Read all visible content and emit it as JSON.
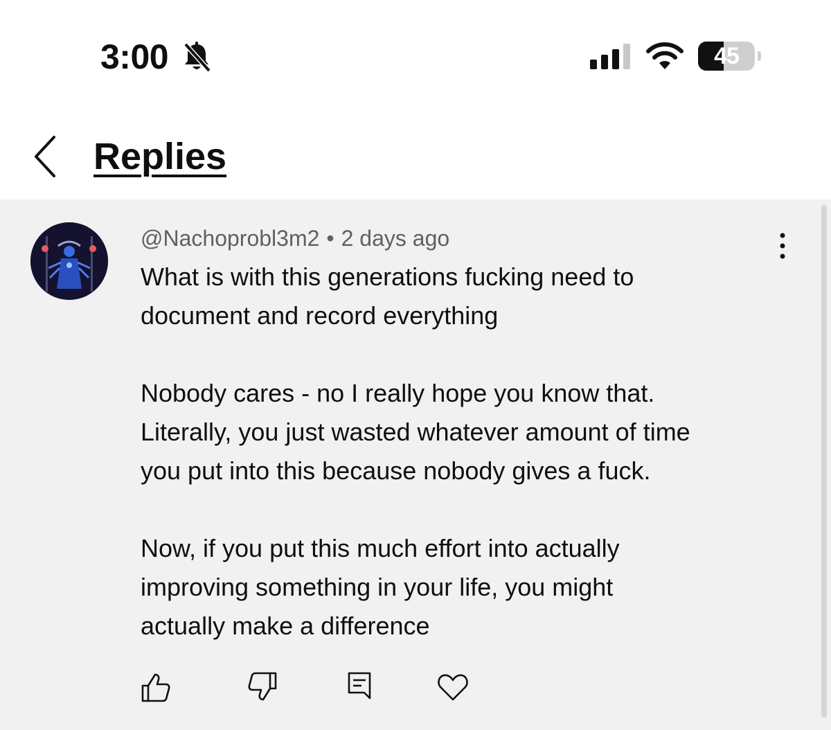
{
  "status_bar": {
    "time": "3:00",
    "battery_level": "45",
    "battery_fraction": 0.45,
    "icons": [
      "bell-off-icon",
      "cellular-signal-icon",
      "wifi-icon",
      "battery-icon"
    ]
  },
  "header": {
    "back_icon": "chevron-left-icon",
    "title": "Replies"
  },
  "comment": {
    "author": "@Nachoprobl3m2",
    "separator": "•",
    "timestamp": "2 days ago",
    "more_icon": "vertical-ellipsis-icon",
    "lines": [
      "What is with this generations fucking need to",
      "document and record everything",
      "",
      "Nobody cares - no I really hope you know that.",
      "Literally, you just wasted whatever amount of time",
      "you put into this because nobody gives a fuck.",
      "",
      "Now, if you put this much effort into actually",
      "improving something in your life, you might",
      "actually make a difference"
    ]
  },
  "actions": {
    "icons": [
      "thumbs-up-icon",
      "thumbs-down-icon",
      "reply-icon",
      "heart-icon"
    ]
  },
  "colors": {
    "comment_background": "#f1f1f1",
    "secondary_text": "#606060",
    "primary_text": "#0f0f0f",
    "avatar_background": "#14122e"
  }
}
